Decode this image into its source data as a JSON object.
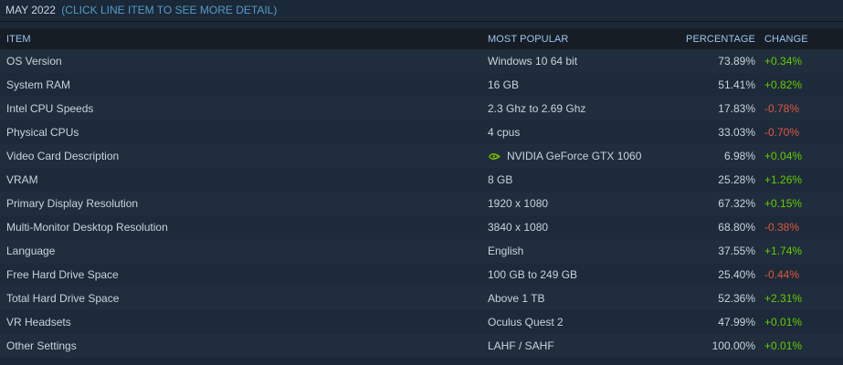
{
  "header": {
    "title": "MAY 2022",
    "hint": "(CLICK LINE ITEM TO SEE MORE DETAIL)"
  },
  "columns": {
    "item": "ITEM",
    "most_popular": "MOST POPULAR",
    "percentage": "PERCENTAGE",
    "change": "CHANGE"
  },
  "colors": {
    "positive": "#66cc00",
    "negative": "#e0573d",
    "header_text": "#9bc5f3",
    "nvidia": "#76b900"
  },
  "rows": [
    {
      "item": "OS Version",
      "most_popular": "Windows 10 64 bit",
      "percentage": "73.89%",
      "change": "+0.34%",
      "trend": "pos"
    },
    {
      "item": "System RAM",
      "most_popular": "16 GB",
      "percentage": "51.41%",
      "change": "+0.82%",
      "trend": "pos"
    },
    {
      "item": "Intel CPU Speeds",
      "most_popular": "2.3 Ghz to 2.69 Ghz",
      "percentage": "17.83%",
      "change": "-0.78%",
      "trend": "neg"
    },
    {
      "item": "Physical CPUs",
      "most_popular": "4 cpus",
      "percentage": "33.03%",
      "change": "-0.70%",
      "trend": "neg"
    },
    {
      "item": "Video Card Description",
      "most_popular": "NVIDIA GeForce GTX 1060",
      "percentage": "6.98%",
      "change": "+0.04%",
      "trend": "pos",
      "icon": "nvidia-logo-icon"
    },
    {
      "item": "VRAM",
      "most_popular": "8 GB",
      "percentage": "25.28%",
      "change": "+1.26%",
      "trend": "pos"
    },
    {
      "item": "Primary Display Resolution",
      "most_popular": "1920 x 1080",
      "percentage": "67.32%",
      "change": "+0.15%",
      "trend": "pos"
    },
    {
      "item": "Multi-Monitor Desktop Resolution",
      "most_popular": "3840 x 1080",
      "percentage": "68.80%",
      "change": "-0.38%",
      "trend": "neg"
    },
    {
      "item": "Language",
      "most_popular": "English",
      "percentage": "37.55%",
      "change": "+1.74%",
      "trend": "pos"
    },
    {
      "item": "Free Hard Drive Space",
      "most_popular": "100 GB to 249 GB",
      "percentage": "25.40%",
      "change": "-0.44%",
      "trend": "neg"
    },
    {
      "item": "Total Hard Drive Space",
      "most_popular": "Above 1 TB",
      "percentage": "52.36%",
      "change": "+2.31%",
      "trend": "pos"
    },
    {
      "item": "VR Headsets",
      "most_popular": "Oculus Quest 2",
      "percentage": "47.99%",
      "change": "+0.01%",
      "trend": "pos"
    },
    {
      "item": "Other Settings",
      "most_popular": "LAHF / SAHF",
      "percentage": "100.00%",
      "change": "+0.01%",
      "trend": "pos"
    }
  ]
}
